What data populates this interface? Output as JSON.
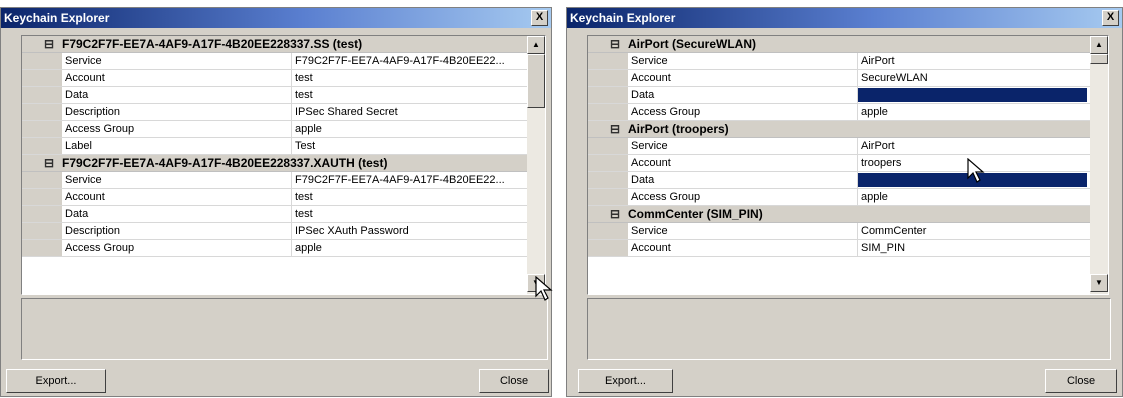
{
  "left": {
    "title": "Keychain Explorer",
    "close_glyph": "X",
    "rows": [
      {
        "type": "header",
        "toggle": "⊟",
        "text": "F79C2F7F-EE7A-4AF9-A17F-4B20EE228337.SS (test)"
      },
      {
        "type": "field",
        "key": "Service",
        "value": "F79C2F7F-EE7A-4AF9-A17F-4B20EE22..."
      },
      {
        "type": "field",
        "key": "Account",
        "value": "test"
      },
      {
        "type": "field",
        "key": "Data",
        "value": "test"
      },
      {
        "type": "field",
        "key": "Description",
        "value": "IPSec Shared Secret"
      },
      {
        "type": "field",
        "key": "Access Group",
        "value": "apple"
      },
      {
        "type": "field",
        "key": "Label",
        "value": "Test"
      },
      {
        "type": "header",
        "toggle": "⊟",
        "text": "F79C2F7F-EE7A-4AF9-A17F-4B20EE228337.XAUTH (test)"
      },
      {
        "type": "field",
        "key": "Service",
        "value": "F79C2F7F-EE7A-4AF9-A17F-4B20EE22..."
      },
      {
        "type": "field",
        "key": "Account",
        "value": "test"
      },
      {
        "type": "field",
        "key": "Data",
        "value": "test"
      },
      {
        "type": "field",
        "key": "Description",
        "value": "IPSec XAuth Password"
      },
      {
        "type": "field",
        "key": "Access Group",
        "value": "apple"
      }
    ],
    "export_label": "Export...",
    "close_label": "Close"
  },
  "right": {
    "title": "Keychain Explorer",
    "close_glyph": "X",
    "rows": [
      {
        "type": "header",
        "toggle": "⊟",
        "text": "AirPort (SecureWLAN)"
      },
      {
        "type": "field",
        "key": "Service",
        "value": "AirPort"
      },
      {
        "type": "field",
        "key": "Account",
        "value": "SecureWLAN"
      },
      {
        "type": "field",
        "key": "Data",
        "value": "",
        "selected": true
      },
      {
        "type": "field",
        "key": "Access Group",
        "value": "apple"
      },
      {
        "type": "header",
        "toggle": "⊟",
        "text": "AirPort (troopers)"
      },
      {
        "type": "field",
        "key": "Service",
        "value": "AirPort"
      },
      {
        "type": "field",
        "key": "Account",
        "value": "troopers"
      },
      {
        "type": "field",
        "key": "Data",
        "value": "",
        "selected": true
      },
      {
        "type": "field",
        "key": "Access Group",
        "value": "apple"
      },
      {
        "type": "header",
        "toggle": "⊟",
        "text": "CommCenter (SIM_PIN)"
      },
      {
        "type": "field",
        "key": "Service",
        "value": "CommCenter"
      },
      {
        "type": "field",
        "key": "Account",
        "value": "SIM_PIN"
      }
    ],
    "export_label": "Export...",
    "close_label": "Close"
  },
  "colors": {
    "titlebar": "#0a246a",
    "selection": "#0a246a",
    "window_face": "#d4d0c8"
  },
  "icons": {
    "scroll_up": "up-arrow-icon",
    "scroll_down": "down-arrow-icon",
    "cursor": "mouse-pointer-icon",
    "collapse": "collapse-box-icon"
  }
}
